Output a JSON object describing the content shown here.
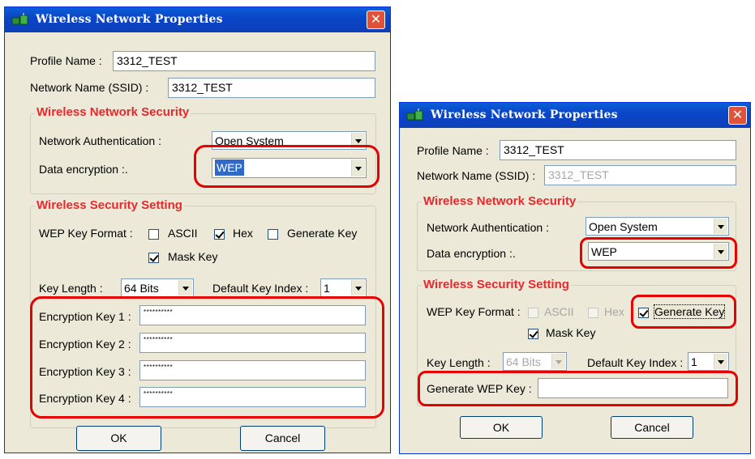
{
  "dialog1": {
    "title": "Wireless Network Properties",
    "profile_name_label": "Profile Name :",
    "profile_name_value": "3312_TEST",
    "ssid_label": "Network Name (SSID) :",
    "ssid_value": "3312_TEST",
    "security_group": "Wireless Network Security",
    "auth_label": "Network Authentication :",
    "auth_value": "Open System",
    "enc_label": "Data encryption :.",
    "enc_value": "WEP",
    "setting_group": "Wireless Security Setting",
    "wep_format_label": "WEP Key Format :",
    "ascii_label": "ASCII",
    "hex_label": "Hex",
    "generate_label": "Generate Key",
    "mask_label": "Mask Key",
    "key_length_label": "Key Length :",
    "key_length_value": "64 Bits",
    "default_index_label": "Default Key Index :",
    "default_index_value": "1",
    "key1_label": "Encryption Key 1 :",
    "key2_label": "Encryption Key 2 :",
    "key3_label": "Encryption Key 3 :",
    "key4_label": "Encryption Key 4 :",
    "key_masked": "**********",
    "ok_label": "OK",
    "cancel_label": "Cancel",
    "checks": {
      "ascii": false,
      "hex": true,
      "generate": false,
      "mask": true
    }
  },
  "dialog2": {
    "title": "Wireless Network Properties",
    "profile_name_label": "Profile Name :",
    "profile_name_value": "3312_TEST",
    "ssid_label": "Network Name (SSID) :",
    "ssid_value": "3312_TEST",
    "security_group": "Wireless Network Security",
    "auth_label": "Network Authentication :",
    "auth_value": "Open System",
    "enc_label": "Data encryption :.",
    "enc_value": "WEP",
    "setting_group": "Wireless Security Setting",
    "wep_format_label": "WEP Key Format :",
    "ascii_label": "ASCII",
    "hex_label": "Hex",
    "generate_label": "Generate Key",
    "mask_label": "Mask Key",
    "key_length_label": "Key Length :",
    "key_length_value": "64 Bits",
    "default_index_label": "Default Key Index :",
    "default_index_value": "1",
    "gen_wep_label": "Generate WEP Key :",
    "gen_wep_value": "",
    "ok_label": "OK",
    "cancel_label": "Cancel",
    "checks": {
      "ascii": false,
      "hex": false,
      "generate": true,
      "mask": true
    }
  },
  "colors": {
    "highlight": "#e60000",
    "group_title": "#e8282c",
    "titlebar": "#0a4fd0",
    "dialog_bg": "#ece9d8"
  }
}
